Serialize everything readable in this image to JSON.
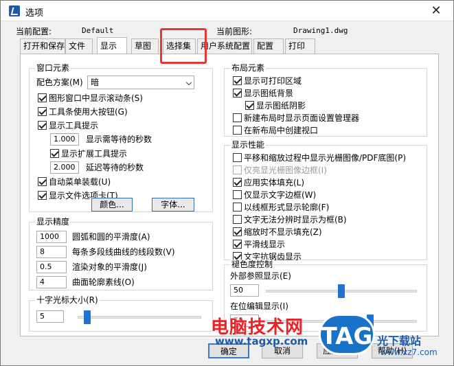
{
  "window": {
    "title": "选项",
    "close_glyph": "✕"
  },
  "info": {
    "current_config_label": "当前配置:",
    "current_config_value": "Default",
    "current_drawing_label": "当前图形:",
    "current_drawing_value": "Drawing1.dwg"
  },
  "tabs": [
    "打开和保存",
    "文件",
    "显示",
    "草图",
    "选择集",
    "用户系统配置",
    "配置",
    "打印"
  ],
  "active_tab": "显示",
  "window_elements": {
    "title": "窗口元素",
    "color_scheme_label": "配色方案(M)",
    "color_scheme_value": "暗",
    "show_scrollbars": "图形窗口中显示滚动条(S)",
    "large_buttons": "工具条使用大按钮(G)",
    "show_tooltips": "显示工具提示",
    "tooltip_delay_value": "1.000",
    "tooltip_delay_label": "显示需等待的秒数",
    "extended_tooltips": "显示扩展工具提示",
    "ext_delay_value": "2.000",
    "ext_delay_label": "延迟等待的秒数",
    "auto_menu": "自动菜单装载(U)",
    "file_tabs": "显示文件选项卡(T)",
    "colors_button": "颜色...",
    "fonts_button": "字体..."
  },
  "display_precision": {
    "title": "显示精度",
    "arc_value": "1000",
    "arc_label": "圆弧和圆的平滑度(A)",
    "polyline_value": "8",
    "polyline_label": "每条多段线曲线的线段数(V)",
    "render_value": "0.5",
    "render_label": "渲染对象的平滑度(J)",
    "contour_value": "4",
    "contour_label": "曲面轮廓素线(O)"
  },
  "crosshair": {
    "title": "十字光标大小(R)",
    "value": "5",
    "level_percent": 5
  },
  "layout_elements": {
    "title": "布局元素",
    "print_area": "显示可打印区域",
    "paper_bg": "显示图纸背景",
    "paper_shadow": "显示图纸阴影",
    "page_setup": "新建布局时显示页面设置管理器",
    "create_viewport": "在新布局中创建视口"
  },
  "display_performance": {
    "title": "显示性能",
    "raster_pan": "平移和缩放过程中显示光栅图像/PDF底图(P)",
    "highlight_raster": "仅亮显光栅图像边框(I)",
    "solid_fill": "应用实体填充(L)",
    "text_frame": "仅显示文字边框(W)",
    "wireframe_silhouette": "以线框形式显示轮廓(F)",
    "text_box": "文字无法分辨时显示为框(B)",
    "zoom_no_fill": "缩放时不显示填充(Z)",
    "smooth_lines": "平滑线显示",
    "text_antialias": "文字抗锯齿显示"
  },
  "fade_control": {
    "title": "褪色度控制",
    "xref_label": "外部参照显示(E)",
    "xref_value": "50",
    "xref_level_percent": 50,
    "inplace_label": "在位编辑显示(I)",
    "inplace_value": "70",
    "inplace_level_percent": 70
  },
  "buttons": {
    "ok": "确定",
    "cancel": "取消",
    "apply": "应用(A)",
    "help": "帮助(H)"
  },
  "watermark": {
    "brand_text": "电脑技术网",
    "brand_url": "www.tagxp.com",
    "tag_text": "TAG",
    "site_text": "光下载站",
    "site_url": "www.xz7.com"
  }
}
